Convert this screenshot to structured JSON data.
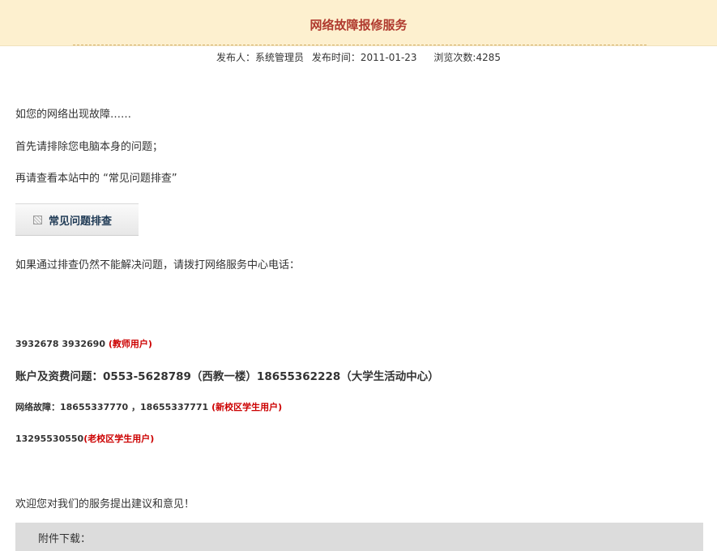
{
  "article": {
    "title": "网络故障报修服务",
    "meta": {
      "publisher": "发布人：系统管理员",
      "publish_time": "发布时间：2011-01-23",
      "views": "浏览次数:4285"
    },
    "paragraphs": {
      "p1": "如您的网络出现故障……",
      "p2": "首先请排除您电脑本身的问题；",
      "p3": "再请查看本站中的 “常见问题排查”",
      "p4": "如果通过排查仍然不能解决问题，请拨打网络服务中心电话：",
      "closing": "欢迎您对我们的服务提出建议和意见！"
    },
    "faq_button": "常见问题排查",
    "phones": {
      "line1_numbers": "3932678  3932690",
      "line1_note": "(教师用户)",
      "line2": "账户及资费问题：0553-5628789（西教一楼）18655362228（大学生活动中心）",
      "line3_numbers": "网络故障：18655337770  ，18655337771",
      "line3_note": "(新校区学生用户)",
      "line4_numbers": "13295530550",
      "line4_note": "(老校区学生用户)"
    },
    "attachment_label": "附件下载："
  }
}
